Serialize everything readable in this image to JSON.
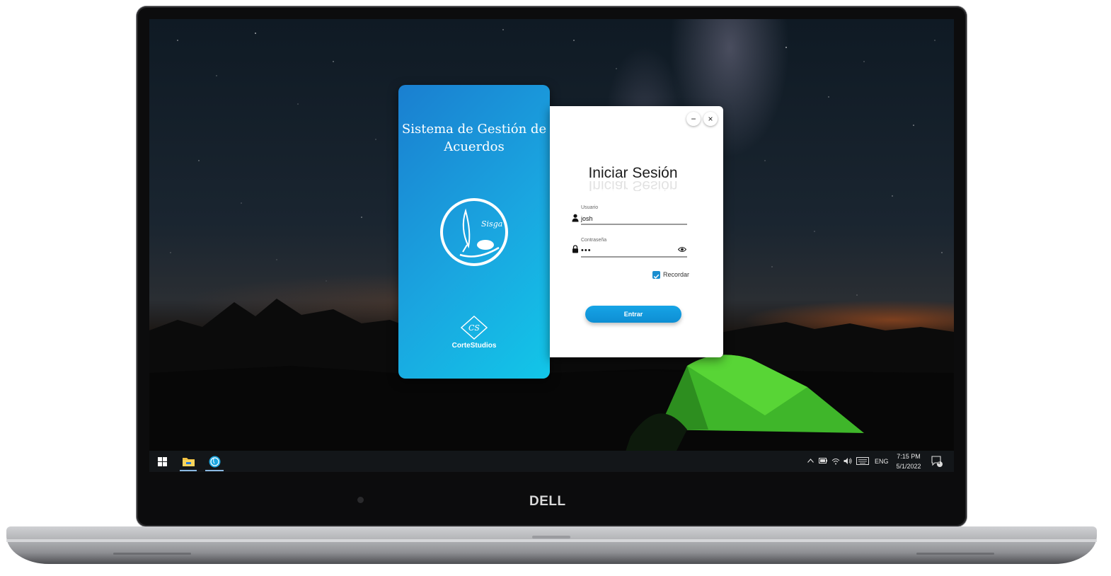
{
  "brand": {
    "title": "Sistema de Gestión de Acuerdos",
    "logo_text": "Sisga",
    "studio_logo_text": "CS",
    "studio_name": "CorteStudios"
  },
  "login": {
    "title": "Iniciar Sesión",
    "username_label": "Usuario",
    "username_value": "josh",
    "password_label": "Contraseña",
    "password_value": "•••",
    "remember_label": "Recordar",
    "remember_checked": true,
    "submit_label": "Entrar",
    "minimize_symbol": "−",
    "close_symbol": "×"
  },
  "taskbar": {
    "apps": [
      "file-explorer",
      "sisga-app"
    ],
    "language": "ENG",
    "time": "7:15 PM",
    "date": "5/1/2022",
    "notification_count": "4"
  },
  "laptop": {
    "brand": "DELL"
  },
  "colors": {
    "accent_blue": "#1a8ed0",
    "card_gradient_start": "#1a7fd0",
    "card_gradient_end": "#12c6e8",
    "taskbar": "#131619"
  }
}
